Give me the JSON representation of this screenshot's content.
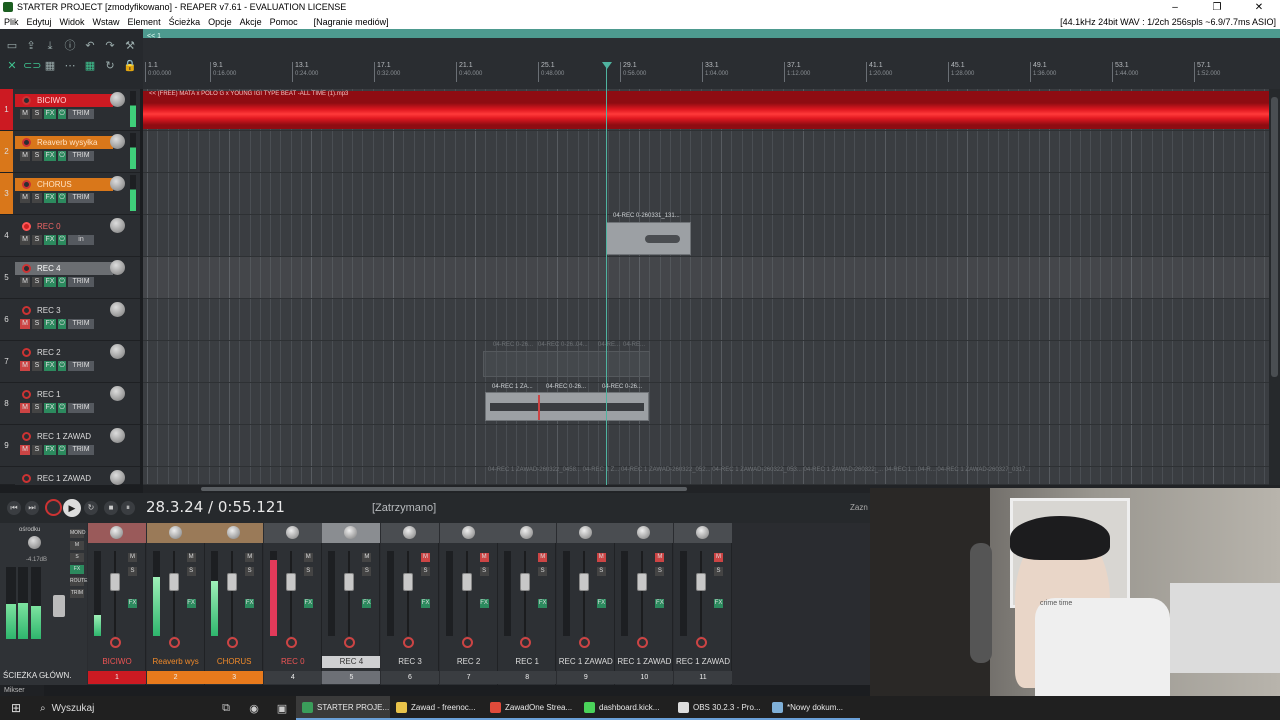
{
  "window": {
    "title": "STARTER PROJECT [zmodyfikowano] - REAPER v7.61 - EVALUATION LICENSE",
    "controls": [
      "–",
      "❐",
      "✕"
    ]
  },
  "menu": {
    "items": [
      "Plik",
      "Edytuj",
      "Widok",
      "Wstaw",
      "Element",
      "Ścieżka",
      "Opcje",
      "Akcje",
      "Pomoc",
      "[Nagranie mediów]"
    ],
    "device_info": "[44.1kHz 24bit WAV : 1/2ch 256spls ~6.9/7.7ms ASIO]"
  },
  "region_marker": "<< 1",
  "ruler": [
    {
      "bar": "1.1",
      "time": "0:00.000"
    },
    {
      "bar": "9.1",
      "time": "0:16.000"
    },
    {
      "bar": "13.1",
      "time": "0:24.000"
    },
    {
      "bar": "17.1",
      "time": "0:32.000"
    },
    {
      "bar": "21.1",
      "time": "0:40.000"
    },
    {
      "bar": "25.1",
      "time": "0:48.000"
    },
    {
      "bar": "29.1",
      "time": "0:56.000"
    },
    {
      "bar": "33.1",
      "time": "1:04.000"
    },
    {
      "bar": "37.1",
      "time": "1:12.000"
    },
    {
      "bar": "41.1",
      "time": "1:20.000"
    },
    {
      "bar": "45.1",
      "time": "1:28.000"
    },
    {
      "bar": "49.1",
      "time": "1:36.000"
    },
    {
      "bar": "53.1",
      "time": "1:44.000"
    },
    {
      "bar": "57.1",
      "time": "1:52.000"
    }
  ],
  "tracks": [
    {
      "num": "1",
      "name": "BICIWO",
      "color": "#cc1a22",
      "armed": false
    },
    {
      "num": "2",
      "name": "Reaverb wysyłka",
      "color": "#d9771a",
      "armed": false
    },
    {
      "num": "3",
      "name": "CHORUS",
      "color": "#d9771a",
      "armed": false
    },
    {
      "num": "4",
      "name": "REC 0",
      "color": "#2b2e32",
      "armed": true
    },
    {
      "num": "5",
      "name": "REC 4",
      "color": "#44484d",
      "armed": false
    },
    {
      "num": "6",
      "name": "REC 3",
      "color": "#2b2e32",
      "armed": false
    },
    {
      "num": "7",
      "name": "REC 2",
      "color": "#2b2e32",
      "armed": false
    },
    {
      "num": "8",
      "name": "REC 1",
      "color": "#2b2e32",
      "armed": false
    },
    {
      "num": "9",
      "name": "REC 1 ZAWAD",
      "color": "#2b2e32",
      "armed": false
    },
    {
      "num": "",
      "name": "REC 1 ZAWAD",
      "color": "#2b2e32",
      "armed": false
    }
  ],
  "track_buttons": {
    "mute": "M",
    "solo": "S",
    "fx": "FX",
    "trim": "TRIM",
    "input": "in"
  },
  "items": {
    "beat": "<< (FREE) MATA x POLO G x YOUNG IGI TYPE BEAT -ALL TIME (1).mp3",
    "rec4_take": "04-REC 0-260331_131...",
    "rec1_takes": [
      "04-REC 1 ZA...",
      "04-REC 0-26...",
      "04-REC 0-26..."
    ],
    "ghost_labels": [
      "04-REC 0-26...",
      "04-REC 0-26...",
      "04...",
      "04-RE...",
      "04-RE..."
    ],
    "bottom_ghost": "04-REC 1 ZAWAD-260322_0458...   04-REC 1 Z...   04-REC 1 ZAWAD-260322_052...   04-REC 1 ZAWAD-260322_053...   04-REC 1 ZAWAD-260322_...   04-REC 1...   04-R...   04-REC 1 ZAWAD-260327_0317..."
  },
  "transport": {
    "position": "28.3.24 / 0:55.121",
    "status": "[Zatrzymano]",
    "zazn": "Zazn"
  },
  "master": {
    "label_top": "ośrodku",
    "db": "-4.17dB",
    "name": "ŚCIEŻKA GŁÓWN.",
    "tab": "Mikser",
    "buttons": [
      "MONO",
      "M",
      "S",
      "FX",
      "ROUTE",
      "TRIM"
    ]
  },
  "mixer_strips": [
    {
      "name": "BICIWO",
      "index": "1",
      "color": "#cc1a22",
      "name_color": "#e55",
      "top": "#9a5a5a",
      "meter": 0.25,
      "mute": false
    },
    {
      "name": "Reaverb wys",
      "index": "2",
      "color": "#e87a1c",
      "name_color": "#f08a2a",
      "top": "#9a7a58",
      "meter": 0.7,
      "mute": false
    },
    {
      "name": "CHORUS",
      "index": "3",
      "color": "#e87a1c",
      "name_color": "#f08a2a",
      "top": "#9a7a58",
      "meter": 0.65,
      "mute": false
    },
    {
      "name": "REC 0",
      "index": "4",
      "color": "#3a3d41",
      "name_color": "#e55",
      "top": "#4a4d51",
      "meter": 0.9,
      "mute": false
    },
    {
      "name": "REC 4",
      "index": "5",
      "color": "#6d7076",
      "name_color": "#333",
      "top": "#8a8d91",
      "meter": 0.0,
      "mute": false
    },
    {
      "name": "REC 3",
      "index": "6",
      "color": "#3a3d41",
      "name_color": "#ddd",
      "top": "#4a4d51",
      "meter": 0.0,
      "mute": true
    },
    {
      "name": "REC 2",
      "index": "7",
      "color": "#3a3d41",
      "name_color": "#ddd",
      "top": "#4a4d51",
      "meter": 0.0,
      "mute": true
    },
    {
      "name": "REC 1",
      "index": "8",
      "color": "#3a3d41",
      "name_color": "#ddd",
      "top": "#4a4d51",
      "meter": 0.0,
      "mute": true
    },
    {
      "name": "REC 1 ZAWAD",
      "index": "9",
      "color": "#3a3d41",
      "name_color": "#ddd",
      "top": "#4a4d51",
      "meter": 0.0,
      "mute": true
    },
    {
      "name": "REC 1 ZAWAD",
      "index": "10",
      "color": "#3a3d41",
      "name_color": "#ddd",
      "top": "#4a4d51",
      "meter": 0.0,
      "mute": true
    },
    {
      "name": "REC 1 ZAWAD",
      "index": "11",
      "color": "#3a3d41",
      "name_color": "#ddd",
      "top": "#4a4d51",
      "meter": 0.0,
      "mute": true
    }
  ],
  "taskbar": {
    "search": "Wyszukaj",
    "apps": [
      {
        "label": "STARTER PROJE...",
        "color": "#3a9d5a",
        "active": true
      },
      {
        "label": "Zawad - freenoc...",
        "color": "#e9c34a",
        "active": false
      },
      {
        "label": "ZawadOne Strea...",
        "color": "#e04a3a",
        "active": false
      },
      {
        "label": "dashboard.kick...",
        "color": "#4ad35a",
        "active": false
      },
      {
        "label": "OBS 30.2.3 - Pro...",
        "color": "#dddddd",
        "active": false
      },
      {
        "label": "*Nowy dokum...",
        "color": "#7fb0d8",
        "active": false
      }
    ]
  },
  "webcam": {
    "poster_text": "crime time"
  }
}
